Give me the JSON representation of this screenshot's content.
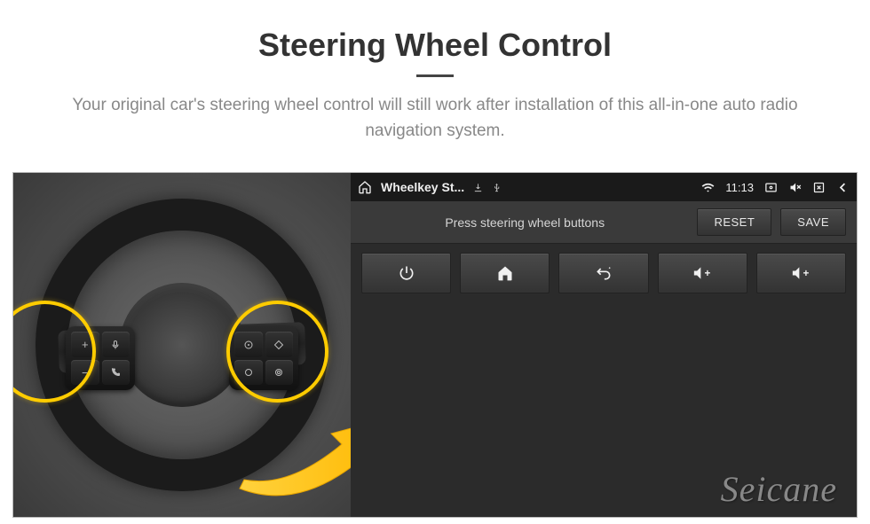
{
  "header": {
    "title": "Steering Wheel Control",
    "subtitle": "Your original car's steering wheel control will still work after installation of this all-in-one auto radio navigation system."
  },
  "status_bar": {
    "app_title": "Wheelkey St...",
    "time": "11:13"
  },
  "toolbar": {
    "instruction": "Press steering wheel buttons",
    "reset_label": "RESET",
    "save_label": "SAVE"
  },
  "key_buttons": [
    {
      "name": "power"
    },
    {
      "name": "home"
    },
    {
      "name": "back"
    },
    {
      "name": "volume-up-1"
    },
    {
      "name": "volume-up-2"
    }
  ],
  "watermark": "Seicane"
}
